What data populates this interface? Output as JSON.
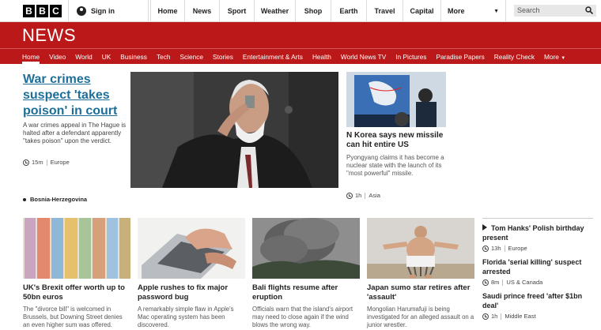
{
  "topbar": {
    "logo_letters": [
      "B",
      "B",
      "C"
    ],
    "signin": "Sign in",
    "nav": [
      "Home",
      "News",
      "Sport",
      "Weather",
      "Shop",
      "Earth",
      "Travel",
      "Capital",
      "More"
    ],
    "search_placeholder": "Search"
  },
  "news": {
    "title": "NEWS",
    "nav": [
      "Home",
      "Video",
      "World",
      "UK",
      "Business",
      "Tech",
      "Science",
      "Stories",
      "Entertainment & Arts",
      "Health",
      "World News TV",
      "In Pictures",
      "Paradise Papers",
      "Reality Check",
      "More"
    ],
    "active": "Home"
  },
  "main_story": {
    "headline": "War crimes suspect 'takes poison' in court",
    "summary": "A war crimes appeal in The Hague is halted after a defendant apparently \"takes poison\" upon the verdict.",
    "time": "15m",
    "region": "Europe",
    "related": "Bosnia-Herzegovina"
  },
  "nk_story": {
    "headline": "N Korea says new missile can hit entire US",
    "summary": "Pyongyang claims it has become a nuclear state with the launch of its \"most powerful\" missile.",
    "time": "1h",
    "region": "Asia"
  },
  "cards": [
    {
      "headline": "UK's Brexit offer worth up to 50bn euros",
      "summary": "The \"divorce bill\" is welcomed in Brussels, but Downing Street denies an even higher sum was offered."
    },
    {
      "headline": "Apple rushes to fix major password bug",
      "summary": "A remarkably simple flaw in Apple's Mac operating system has been discovered."
    },
    {
      "headline": "Bali flights resume after eruption",
      "summary": "Officials warn that the island's airport may need to close again if the wind blows the wrong way."
    },
    {
      "headline": "Japan sumo star retires after 'assault'",
      "summary": "Mongolian Harumafuji is being investigated for an alleged assault on a junior wrestler."
    }
  ],
  "right_col": [
    {
      "headline": "Tom Hanks' Polish birthday present",
      "time": "13h",
      "region": "Europe",
      "video": true
    },
    {
      "headline": "Florida 'serial killing' suspect arrested",
      "time": "8m",
      "region": "US & Canada",
      "video": false
    },
    {
      "headline": "Saudi prince freed 'after $1bn deal'",
      "time": "1h",
      "region": "Middle East",
      "video": false
    }
  ],
  "colors": {
    "brand_red": "#bb1919",
    "link_blue": "#1d6f99"
  },
  "icons": [
    "user-icon",
    "search-icon",
    "clock-icon",
    "play-icon",
    "chevron-down-icon"
  ]
}
